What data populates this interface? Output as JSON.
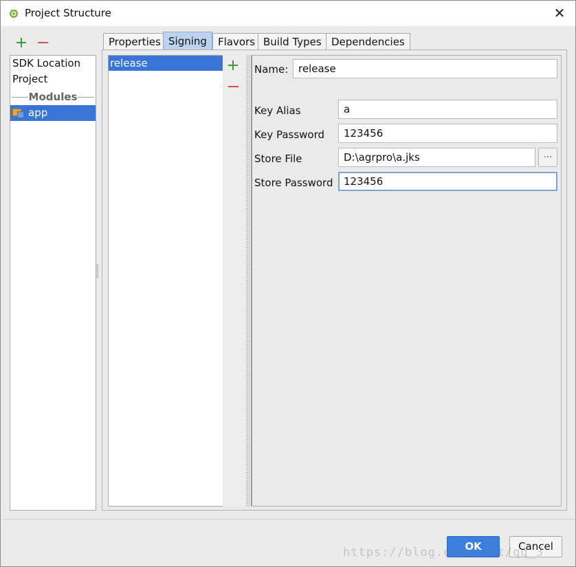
{
  "window": {
    "title": "Project Structure"
  },
  "left_panel": {
    "items": [
      "SDK Location",
      "Project"
    ],
    "section_header": "Modules",
    "modules": [
      "app"
    ]
  },
  "tabs": [
    {
      "label": "Properties",
      "active": false
    },
    {
      "label": "Signing",
      "active": true
    },
    {
      "label": "Flavors",
      "active": false
    },
    {
      "label": "Build Types",
      "active": false
    },
    {
      "label": "Dependencies",
      "active": false
    }
  ],
  "signing": {
    "configs": [
      "release"
    ],
    "form": {
      "name_label": "Name:",
      "name_value": "release",
      "key_alias_label": "Key Alias",
      "key_alias_value": "a",
      "key_password_label": "Key Password",
      "key_password_value": "123456",
      "store_file_label": "Store File",
      "store_file_value": "D:\\agrpro\\a.jks",
      "browse_label": "...",
      "store_password_label": "Store Password",
      "store_password_value": "123456"
    }
  },
  "buttons": {
    "ok": "OK",
    "cancel": "Cancel"
  },
  "watermark": "https://blog.csdn.net/qq_3",
  "colors": {
    "selection": "#3875d7",
    "active_tab": "#bcd2ee",
    "add": "#3a9b3a",
    "remove": "#d94b4b",
    "ok_button": "#3a7ee0"
  },
  "icons": {
    "title": "android-icon",
    "add": "plus-icon",
    "remove": "minus-icon",
    "module": "module-folder-icon",
    "close": "close-icon"
  }
}
